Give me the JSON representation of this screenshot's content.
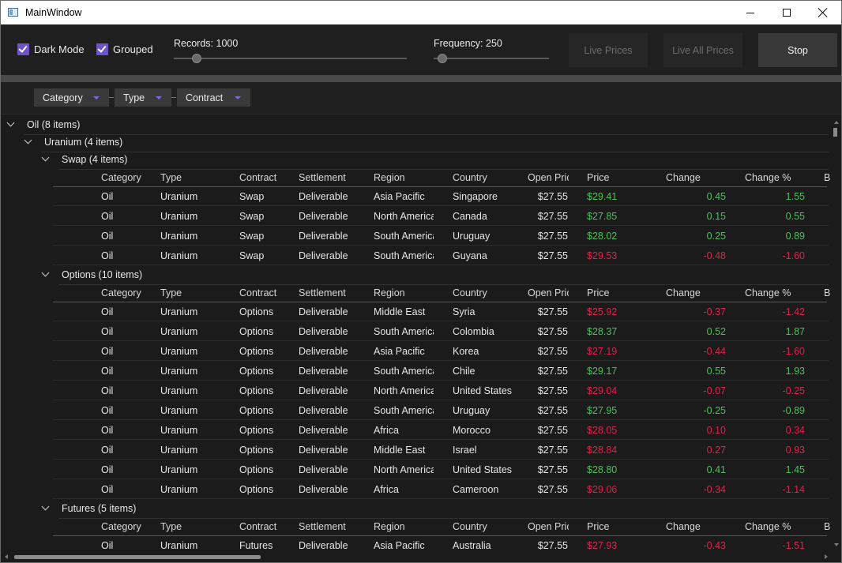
{
  "window": {
    "title": "MainWindow"
  },
  "toolbar": {
    "dark_mode_label": "Dark Mode",
    "dark_mode_checked": true,
    "grouped_label": "Grouped",
    "grouped_checked": true,
    "records_label": "Records: 1000",
    "frequency_label": "Frequency: 250",
    "live_prices_label": "Live Prices",
    "live_all_prices_label": "Live All Prices",
    "stop_label": "Stop"
  },
  "group_panel": {
    "chips": [
      {
        "label": "Category"
      },
      {
        "label": "Type"
      },
      {
        "label": "Contract"
      }
    ]
  },
  "colors": {
    "accent": "#6e54c8",
    "positive": "#4fbf5c",
    "negative": "#e0204a",
    "background": "#1b1b1b"
  },
  "grid": {
    "columns": [
      "Category",
      "Type",
      "Contract",
      "Settlement",
      "Region",
      "Country",
      "Open Pric",
      "Price",
      "Change",
      "Change %",
      "B"
    ],
    "top_group": "Oil (8 items)",
    "sub_group": "Uranium (4 items)",
    "contract_groups": [
      {
        "label": "Swap (4 items)",
        "rows": [
          [
            "Oil",
            "Uranium",
            "Swap",
            "Deliverable",
            "Asia Pacific",
            "Singapore",
            "$27.55",
            "$29.41",
            "0.45",
            "1.55"
          ],
          [
            "Oil",
            "Uranium",
            "Swap",
            "Deliverable",
            "North America",
            "Canada",
            "$27.55",
            "$27.85",
            "0.15",
            "0.55"
          ],
          [
            "Oil",
            "Uranium",
            "Swap",
            "Deliverable",
            "South America",
            "Uruguay",
            "$27.55",
            "$28.02",
            "0.25",
            "0.89"
          ],
          [
            "Oil",
            "Uranium",
            "Swap",
            "Deliverable",
            "South America",
            "Guyana",
            "$27.55",
            "$29.53",
            "-0.48",
            "-1.60"
          ]
        ]
      },
      {
        "label": "Options (10 items)",
        "rows": [
          [
            "Oil",
            "Uranium",
            "Options",
            "Deliverable",
            "Middle East",
            "Syria",
            "$27.55",
            "$25.92",
            "-0.37",
            "-1.42"
          ],
          [
            "Oil",
            "Uranium",
            "Options",
            "Deliverable",
            "South America",
            "Colombia",
            "$27.55",
            "$28.37",
            "0.52",
            "1.87"
          ],
          [
            "Oil",
            "Uranium",
            "Options",
            "Deliverable",
            "Asia Pacific",
            "Korea",
            "$27.55",
            "$27.19",
            "-0.44",
            "-1.60"
          ],
          [
            "Oil",
            "Uranium",
            "Options",
            "Deliverable",
            "South America",
            "Chile",
            "$27.55",
            "$29.17",
            "0.55",
            "1.93"
          ],
          [
            "Oil",
            "Uranium",
            "Options",
            "Deliverable",
            "North America",
            "United States",
            "$27.55",
            "$29.04",
            "-0.07",
            "-0.25"
          ],
          [
            "Oil",
            "Uranium",
            "Options",
            "Deliverable",
            "South America",
            "Uruguay",
            "$27.55",
            "$27.95",
            "-0.25",
            "-0.89"
          ],
          [
            "Oil",
            "Uranium",
            "Options",
            "Deliverable",
            "Africa",
            "Morocco",
            "$27.55",
            "$28.05",
            "0.10",
            "0.34"
          ],
          [
            "Oil",
            "Uranium",
            "Options",
            "Deliverable",
            "Middle East",
            "Israel",
            "$27.55",
            "$28.84",
            "0.27",
            "0.93"
          ],
          [
            "Oil",
            "Uranium",
            "Options",
            "Deliverable",
            "North America",
            "United States",
            "$27.55",
            "$28.80",
            "0.41",
            "1.45"
          ],
          [
            "Oil",
            "Uranium",
            "Options",
            "Deliverable",
            "Africa",
            "Cameroon",
            "$27.55",
            "$29.06",
            "-0.34",
            "-1.14"
          ]
        ]
      },
      {
        "label": "Futures (5 items)",
        "rows": [
          [
            "Oil",
            "Uranium",
            "Futures",
            "Deliverable",
            "Asia Pacific",
            "Australia",
            "$27.55",
            "$27.93",
            "-0.43",
            "-1.51"
          ]
        ]
      }
    ],
    "row_trends": {
      "Swap (4 items)": [
        "pos",
        "pos",
        "pos",
        "neg"
      ],
      "Options (10 items)": [
        "neg",
        "pos",
        "neg",
        "pos",
        "neg",
        "pos",
        "neg",
        "neg",
        "pos",
        "neg"
      ],
      "Futures (5 items)": [
        "neg"
      ]
    }
  }
}
